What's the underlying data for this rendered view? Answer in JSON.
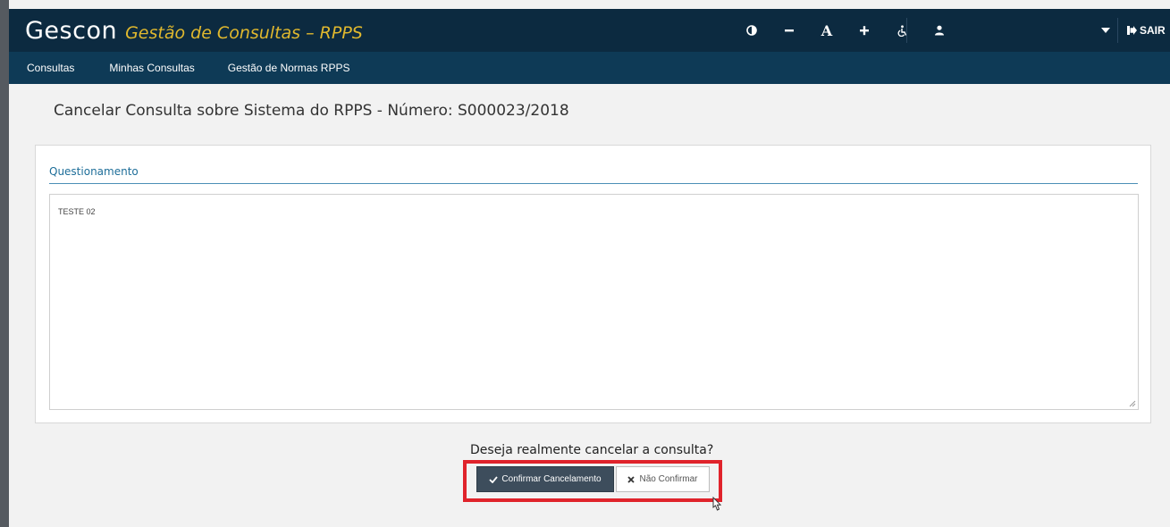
{
  "header": {
    "app_name": "Gescon",
    "app_subtitle": "Gestão de Consultas – RPPS",
    "tools": [
      {
        "icon": "contrast-icon"
      },
      {
        "icon": "decrease-font-icon"
      },
      {
        "icon": "font-size-icon",
        "label": "A"
      },
      {
        "icon": "increase-font-icon"
      },
      {
        "icon": "accessibility-icon"
      },
      {
        "icon": "user-icon"
      }
    ],
    "logout_label": "SAIR",
    "colors": {
      "topbar": "#0c2a40",
      "navbar": "#0e3a56",
      "subtitle": "#e0b82e"
    }
  },
  "nav": {
    "items": [
      {
        "label": "Consultas"
      },
      {
        "label": "Minhas Consultas"
      },
      {
        "label": "Gestão de Normas RPPS"
      }
    ]
  },
  "main": {
    "title": "Cancelar Consulta sobre Sistema do RPPS - Número: S000023/2018",
    "section_label": "Questionamento",
    "question_text": "TESTE 02",
    "confirm_prompt": "Deseja realmente cancelar a consulta?",
    "confirm_button": "Confirmar Cancelamento",
    "cancel_button": "Não Confirmar",
    "colors": {
      "highlight": "#e0232b",
      "confirm_bg": "#3d4d5c"
    }
  }
}
